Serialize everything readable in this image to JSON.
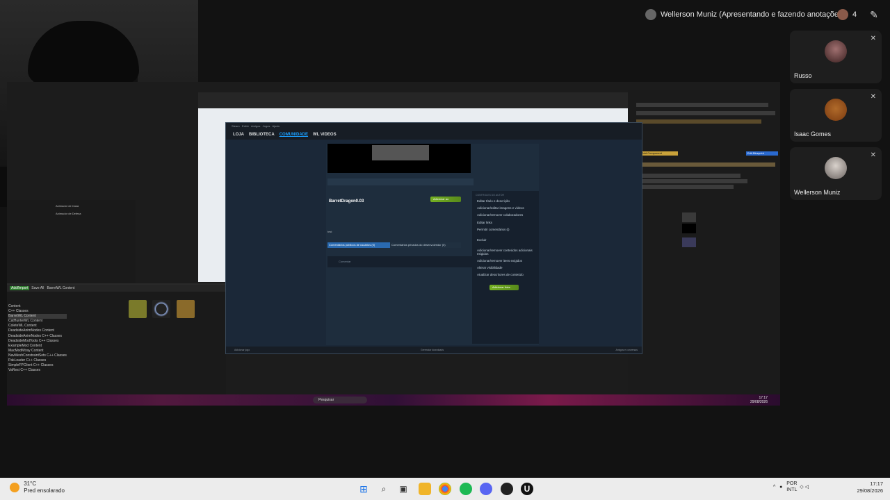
{
  "meet": {
    "presenter_label": "Wellerson Muniz (Apresentando e fazendo anotações)",
    "participant_count": "4",
    "participants": [
      {
        "name": "Russo"
      },
      {
        "name": "Isaac Gomes"
      },
      {
        "name": "Wellerson Muniz"
      }
    ]
  },
  "shared_screen": {
    "unreal": {
      "content_browser_label": "BarretWL Content",
      "add_import_label": "Add/Import",
      "save_all_label": "Save All",
      "left_panel_rows": [
        "Animador de Casa",
        "Animador de Defesa"
      ],
      "folders": [
        "Content",
        "C++ Classes",
        "BarretWL Content",
        "CatHunterWL Content",
        "ColeteWL Content",
        "DeadsideAnimNodes Content",
        "DeadsideAnimNodes C++ Classes",
        "DeadsideModTools C++ Classes",
        "ExampleMod Content",
        "MacModMtray Content",
        "NavMeshConstraintSets C++ Classes",
        "PakLoader C++ Classes",
        "SimpleFPClient C++ Classes",
        "VaRest C++ Classes"
      ],
      "right_panel_button": "Edit Blueprint",
      "add_component_label": "Add Component",
      "taskbar_search": "Pesquisar",
      "taskbar_time": "17:17",
      "taskbar_date": "29/08/2026"
    },
    "steam": {
      "nav": [
        "LOJA",
        "BIBLIOTECA",
        "COMUNIDADE",
        "WL VIDEOS"
      ],
      "active_nav": "COMUNIDADE",
      "item_title": "BarretDragon0.03",
      "add_button": "Adicionar ao",
      "description": "test",
      "tabs": [
        "Comentários públicos de usuários (0)",
        "Comentários privados do desenvolvedor (0)"
      ],
      "comment_placeholder": "Comentar",
      "sidebar_caption": "CONTROLES DO AUTOR",
      "sidebar_items": [
        "Editar título e descrição",
        "Adicionar/editar imagens e vídeos",
        "Adicionar/remover colaboradores",
        "Editar links",
        "Permitir comentários (i)",
        "Excluir",
        "Adicionar/remover conteúdos adicionais exigidos",
        "Adicionar/remover itens exigidos",
        "Alterar visibilidade",
        "Atualizar descritores de conteúdo"
      ],
      "links_button": "Adicionar links",
      "status_left": "Adicionar jogo",
      "status_mid": "Gerenciar downloads",
      "status_right": "Amigos e conversas"
    }
  },
  "taskbar": {
    "temperature": "31°C",
    "weather": "Pred ensolarado",
    "language": "POR",
    "layout": "INTL",
    "time": "17:17",
    "date": "29/08/2026"
  }
}
